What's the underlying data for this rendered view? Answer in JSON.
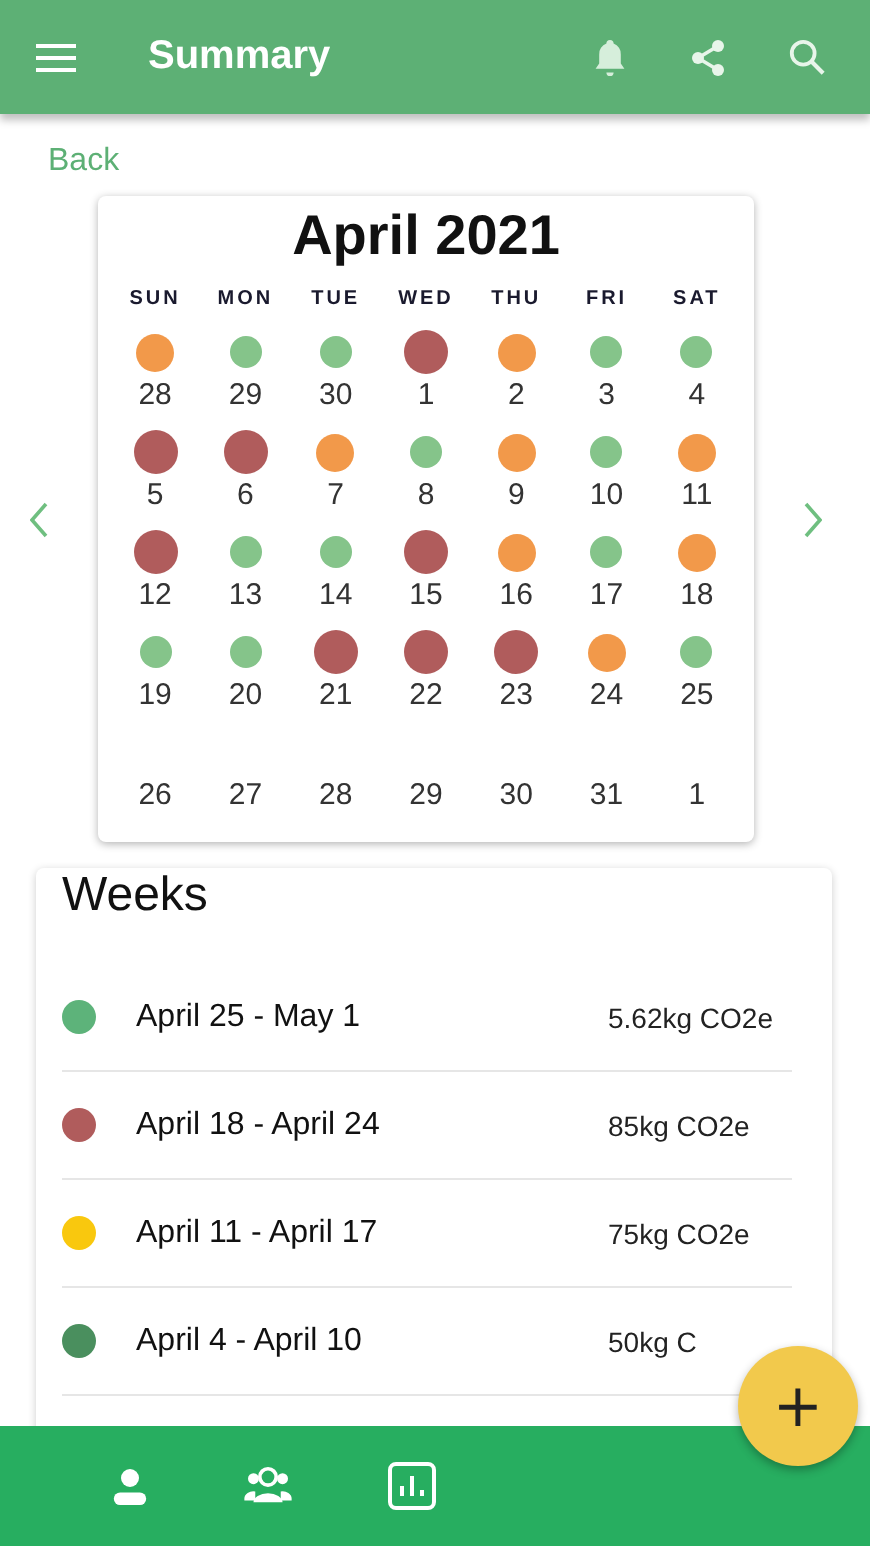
{
  "app_bar": {
    "title": "Summary"
  },
  "back_link": "Back",
  "calendar": {
    "title": "April 2021",
    "weekdays": [
      "SUN",
      "MON",
      "TUE",
      "WED",
      "THU",
      "FRI",
      "SAT"
    ],
    "days": [
      {
        "label": "28",
        "kind": "medium",
        "color": "#f2994a"
      },
      {
        "label": "29",
        "kind": "low",
        "color": "#85c48a"
      },
      {
        "label": "30",
        "kind": "low",
        "color": "#85c48a"
      },
      {
        "label": "1",
        "kind": "high",
        "color": "#b05c5c"
      },
      {
        "label": "2",
        "kind": "medium",
        "color": "#f2994a"
      },
      {
        "label": "3",
        "kind": "low",
        "color": "#85c48a"
      },
      {
        "label": "4",
        "kind": "low",
        "color": "#85c48a"
      },
      {
        "label": "5",
        "kind": "high",
        "color": "#b05c5c"
      },
      {
        "label": "6",
        "kind": "high",
        "color": "#b05c5c"
      },
      {
        "label": "7",
        "kind": "medium",
        "color": "#f2994a"
      },
      {
        "label": "8",
        "kind": "low",
        "color": "#85c48a"
      },
      {
        "label": "9",
        "kind": "medium",
        "color": "#f2994a"
      },
      {
        "label": "10",
        "kind": "low",
        "color": "#85c48a"
      },
      {
        "label": "11",
        "kind": "medium",
        "color": "#f2994a"
      },
      {
        "label": "12",
        "kind": "high",
        "color": "#b05c5c"
      },
      {
        "label": "13",
        "kind": "low",
        "color": "#85c48a"
      },
      {
        "label": "14",
        "kind": "low",
        "color": "#85c48a"
      },
      {
        "label": "15",
        "kind": "high",
        "color": "#b05c5c"
      },
      {
        "label": "16",
        "kind": "medium",
        "color": "#f2994a"
      },
      {
        "label": "17",
        "kind": "low",
        "color": "#85c48a"
      },
      {
        "label": "18",
        "kind": "medium",
        "color": "#f2994a"
      },
      {
        "label": "19",
        "kind": "low",
        "color": "#85c48a"
      },
      {
        "label": "20",
        "kind": "low",
        "color": "#85c48a"
      },
      {
        "label": "21",
        "kind": "high",
        "color": "#b05c5c"
      },
      {
        "label": "22",
        "kind": "high",
        "color": "#b05c5c"
      },
      {
        "label": "23",
        "kind": "high",
        "color": "#b05c5c"
      },
      {
        "label": "24",
        "kind": "medium",
        "color": "#f2994a"
      },
      {
        "label": "25",
        "kind": "low",
        "color": "#85c48a"
      },
      {
        "label": "26",
        "kind": "none"
      },
      {
        "label": "27",
        "kind": "none"
      },
      {
        "label": "28",
        "kind": "none"
      },
      {
        "label": "29",
        "kind": "none"
      },
      {
        "label": "30",
        "kind": "none"
      },
      {
        "label": "31",
        "kind": "none"
      },
      {
        "label": "1",
        "kind": "none"
      }
    ]
  },
  "weeks": {
    "title": "Weeks",
    "items": [
      {
        "range": "April 25 - May 1",
        "amount": "5.62kg CO2e",
        "color": "#5db37a"
      },
      {
        "range": "April 18 - April 24",
        "amount": "85kg CO2e",
        "color": "#b05c5c"
      },
      {
        "range": "April 11 - April 17",
        "amount": "75kg CO2e",
        "color": "#f9c80e"
      },
      {
        "range": "April 4 - April 10",
        "amount": "50kg C",
        "color": "#4a8f5e"
      }
    ]
  },
  "fab": {
    "label": "+"
  }
}
